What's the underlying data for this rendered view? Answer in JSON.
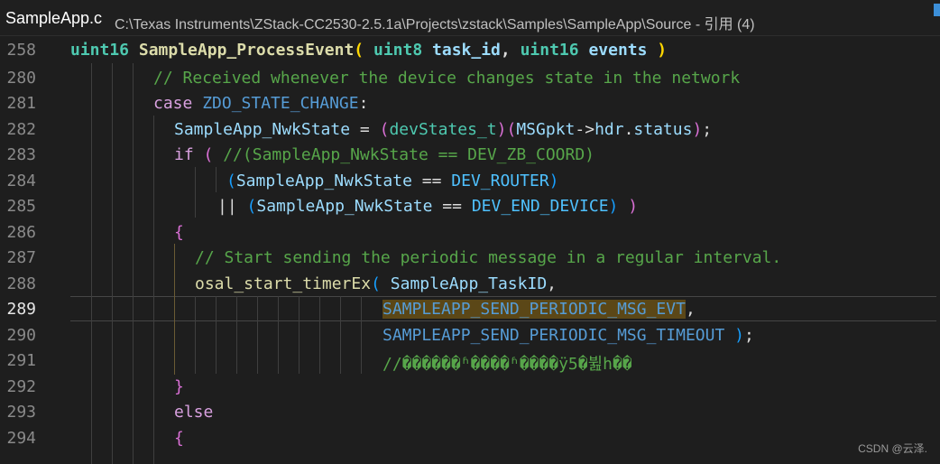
{
  "titlebar": {
    "filename": "SampleApp.c",
    "path": "C:\\Texas Instruments\\ZStack-CC2530-2.5.1a\\Projects\\zstack\\Samples\\SampleApp\\Source - 引用 (4)"
  },
  "editor": {
    "line_numbers": [
      "258",
      "280",
      "281",
      "282",
      "283",
      "284",
      "285",
      "286",
      "287",
      "288",
      "289",
      "290",
      "291",
      "292",
      "293",
      "294"
    ],
    "current_line": "289",
    "lines": {
      "l258": {
        "t1": "uint16",
        "t2": " ",
        "t3": "SampleApp_ProcessEvent",
        "t4": "( ",
        "t5": "uint8",
        "t6": " ",
        "t7": "task_id",
        "t8": ", ",
        "t9": "uint16",
        "t10": " ",
        "t11": "events",
        "t12": " )"
      },
      "l280": {
        "t1": "// Received whenever the device changes state in the network"
      },
      "l281": {
        "t1": "case",
        "t2": " ",
        "t3": "ZDO_STATE_CHANGE",
        "t4": ":"
      },
      "l282": {
        "t1": "SampleApp_NwkState",
        "t2": " = ",
        "t3": "(",
        "t4": "devStates_t",
        "t5": ")",
        "t6": "(",
        "t7": "MSGpkt",
        "t8": "->",
        "t9": "hdr",
        "t10": ".",
        "t11": "status",
        "t12": ")",
        "t13": ";"
      },
      "l283": {
        "t1": "if",
        "t2": " ",
        "t3": "(",
        "t4": " ",
        "t5": "//(SampleApp_NwkState == DEV_ZB_COORD)"
      },
      "l284": {
        "t1": "(",
        "t2": "SampleApp_NwkState",
        "t3": " == ",
        "t4": "DEV_ROUTER",
        "t5": ")"
      },
      "l285": {
        "t1": "||",
        "t2": " ",
        "t3": "(",
        "t4": "SampleApp_NwkState",
        "t5": " == ",
        "t6": "DEV_END_DEVICE",
        "t7": ")",
        "t8": " ",
        "t9": ")"
      },
      "l286": {
        "t1": "{"
      },
      "l287": {
        "t1": "// Start sending the periodic message in a regular interval."
      },
      "l288": {
        "t1": "osal_start_timerEx",
        "t2": "(",
        "t3": " ",
        "t4": "SampleApp_TaskID",
        "t5": ","
      },
      "l289": {
        "t1": "SAMPLEAPP_SEND_PERIODIC_MSG_EVT",
        "t2": ","
      },
      "l290": {
        "t1": "SAMPLEAPP_SEND_PERIODIC_MSG_TIMEOUT",
        "t2": " ",
        "t3": ")",
        "t4": ";"
      },
      "l291": {
        "t1": "//������ʱ����ʱ����ÿ5�뷢һ��"
      },
      "l292": {
        "t1": "}"
      },
      "l293": {
        "t1": "else"
      },
      "l294": {
        "t1": "{"
      }
    }
  },
  "watermark": "CSDN @云泽."
}
